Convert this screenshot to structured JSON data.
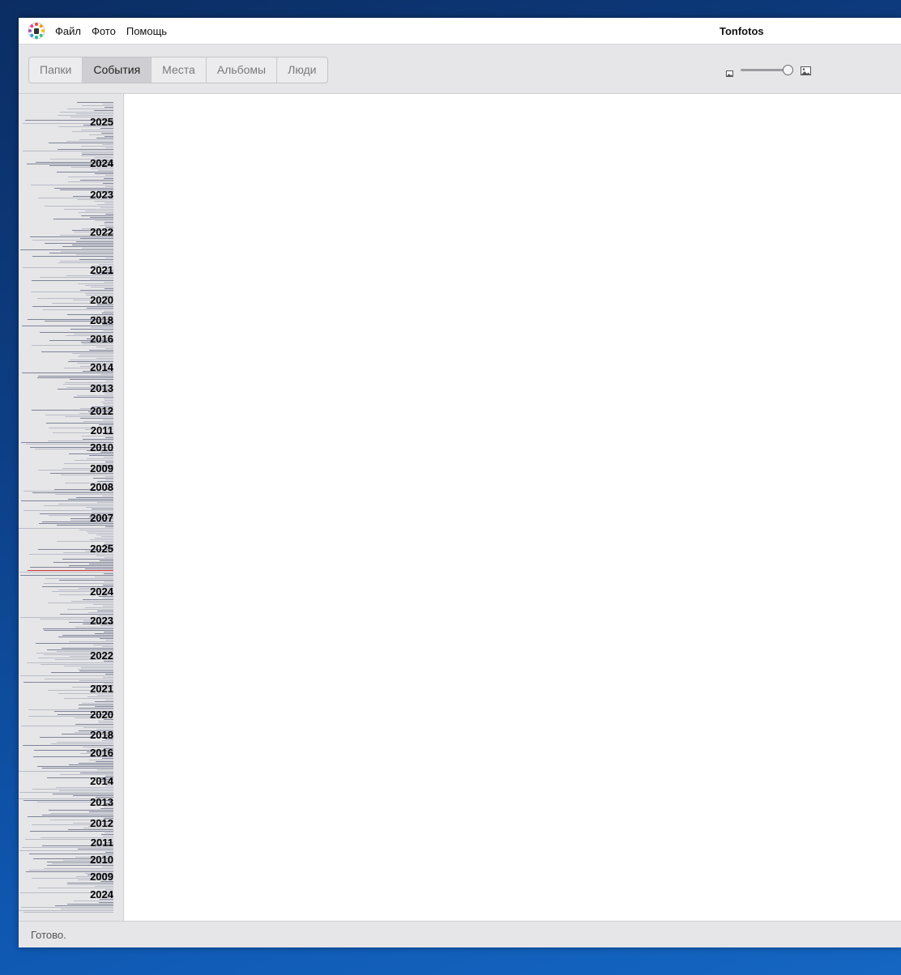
{
  "window": {
    "title": "Tonfotos",
    "app_icon": "tonfotos-logo-icon"
  },
  "menu": {
    "items": [
      "Файл",
      "Фото",
      "Помощь"
    ]
  },
  "tabs": {
    "items": [
      "Папки",
      "События",
      "Места",
      "Альбомы",
      "Люди"
    ],
    "active": "События"
  },
  "zoom": {
    "small_icon": "image-small-icon",
    "large_icon": "image-large-icon",
    "level": 0.95
  },
  "timeline": {
    "years": [
      "2025",
      "2024",
      "2023",
      "2022",
      "2021",
      "2020",
      "2018",
      "2016",
      "2014",
      "2013",
      "2012",
      "2011",
      "2010",
      "2009",
      "2008",
      "2007",
      "2025",
      "2024",
      "2023",
      "2022",
      "2021",
      "2020",
      "2018",
      "2016",
      "2014",
      "2013",
      "2012",
      "2011",
      "2010",
      "2009",
      "2024"
    ]
  },
  "status": {
    "text": "Готово."
  },
  "colors": {
    "active_tab": "#cfcfd3",
    "marker": "#d33333",
    "background": "#e6e6e8"
  }
}
